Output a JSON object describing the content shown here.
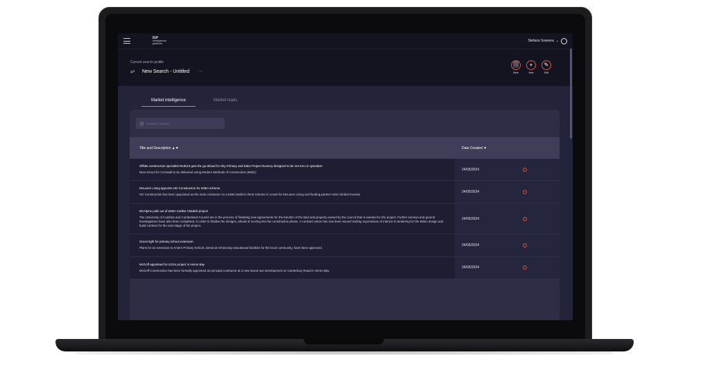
{
  "header": {
    "logo_main": "BiP",
    "logo_sub1": "Intelligence",
    "logo_sub2": "platform",
    "user_name": "Stefano Svanera",
    "user_chevron": "⌄"
  },
  "profile": {
    "label": "Current search profile",
    "name": "New Search - Untitled"
  },
  "actions": [
    {
      "label": "Save",
      "icon": "save-icon",
      "glyph": "🗐"
    },
    {
      "label": "New",
      "icon": "plus-icon",
      "glyph": "+"
    },
    {
      "label": "Edit",
      "icon": "pencil-icon",
      "glyph": "✎"
    }
  ],
  "tabs": [
    {
      "label": "Market intelligence",
      "active": true
    },
    {
      "label": "Market leads",
      "active": false
    }
  ],
  "search": {
    "placeholder": "Keyword Search"
  },
  "table": {
    "col_title": "Title and Description ▲▼",
    "col_date": "Date Created ▼",
    "rows": [
      {
        "title": "Offsite construction specialist Reds10 gets the go-ahead for Sky Primary and Eden Project Nursery designed to be net-zero in operation",
        "description": "New school for Cornwall to be delivered using Modern Methods of Construction (MMC)",
        "date": "24/05/2024"
      },
      {
        "title": "McLaren Living appoints HG Construction for £69m scheme",
        "description": "HG Construction has been appointed as the main contractor on a £69m Build to Rent scheme in Leeds for McLaren Living and funding partner Heim Global Investor.",
        "date": "24/05/2024"
      },
      {
        "title": "McAlpine pulls out of £55m Carlise Citadels project",
        "description": "The University of Cumbria and Cumberland Council are in the process of finalising new agreements for the transfer of the land and property owned by the council that is needed for the project. Further surveys and ground investigations have also been completed, in order to finalise the designs, ahead of moving into the construction phase. A contract notice has now been issued inviting expressions of interest in tendering for the £55m design and build contract for the next stage of the project.",
        "date": "24/05/2024"
      },
      {
        "title": "Green light for primary school extension",
        "description": "Plans for an extension to Antrim Primary School, aimed at enhancing educational facilities for the local community, have been approved.",
        "date": "24/05/2024"
      },
      {
        "title": "McGoff appointed for £21m project in Herne Bay",
        "description": "McGoff Construction has been formally appointed as principal contractor at a new mixed-use development on Canterbury Road in Herne Bay.",
        "date": "24/05/2024"
      }
    ]
  },
  "colors": {
    "accent": "#e0553b",
    "topbar": "#141420",
    "panel": "#2d2d45",
    "row": "#1e1e33"
  }
}
